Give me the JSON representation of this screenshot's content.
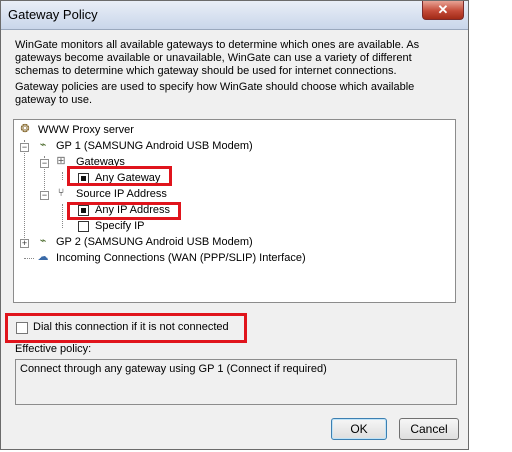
{
  "window": {
    "title": "Gateway Policy",
    "close_glyph": "✕"
  },
  "description": {
    "para1": "WinGate monitors all available gateways to determine which ones are available. As gateways become available or unavailable, WinGate can use a variety of different schemas to determine which gateway should be used for internet connections.",
    "para2": "Gateway policies are used to specify how WinGate should choose which available gateway to use."
  },
  "tree": {
    "root": {
      "label": "WWW Proxy server",
      "icon": "proxy-server-icon"
    },
    "gp1": {
      "label": "GP 1 (SAMSUNG Android USB Modem)",
      "expander": "−",
      "icon": "modem-icon"
    },
    "gateways": {
      "label": "Gateways",
      "expander": "−",
      "icon": "gateways-icon"
    },
    "any_gateway": {
      "label": "Any Gateway",
      "selected": true
    },
    "source_ip": {
      "label": "Source IP Address",
      "expander": "−",
      "icon": "source-ip-icon"
    },
    "any_ip": {
      "label": "Any IP Address",
      "selected": true
    },
    "specify_ip": {
      "label": "Specify IP",
      "selected": false
    },
    "gp2": {
      "label": "GP 2 (SAMSUNG Android USB Modem)",
      "expander": "+",
      "icon": "modem-icon"
    },
    "incoming": {
      "label": "Incoming Connections (WAN (PPP/SLIP) Interface)",
      "icon": "incoming-connections-icon"
    }
  },
  "dial": {
    "label": "Dial this connection if it is not connected",
    "checked": false
  },
  "effective_policy": {
    "label": "Effective policy:",
    "text": "Connect through any gateway using GP 1  (Connect if required)"
  },
  "buttons": {
    "ok": "OK",
    "cancel": "Cancel"
  },
  "colors": {
    "highlight_box": "#e0141c",
    "window_bg": "#f0f0f0"
  }
}
